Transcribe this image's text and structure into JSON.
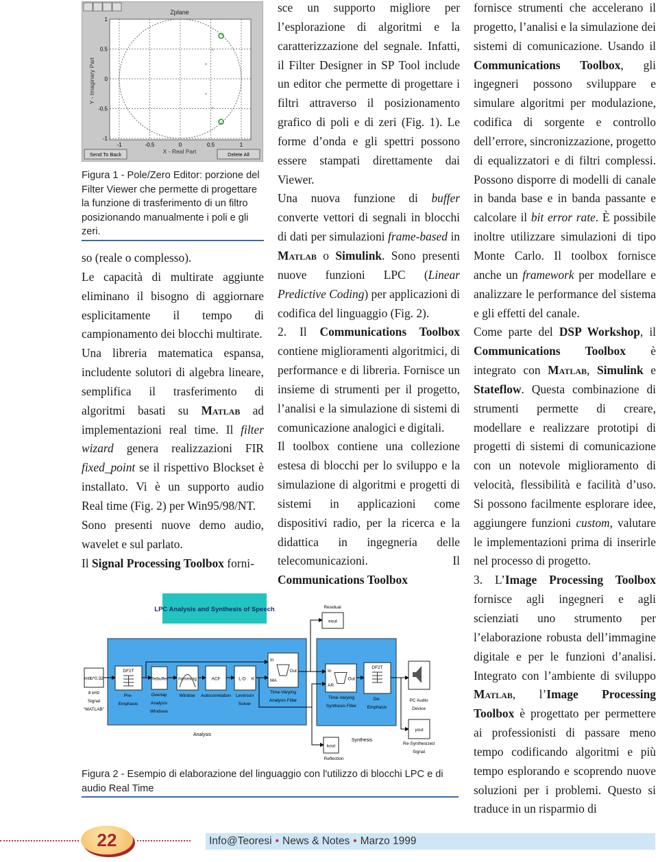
{
  "figure1": {
    "title": "Zplane",
    "toolbar_icons": [
      "pointer-icon",
      "add-pole-icon",
      "add-zero-icon",
      "erase-icon"
    ],
    "ylabel": "Y - Imaginary Part",
    "xlabel": "X - Real Part",
    "xticks": [
      "-1",
      "-0.5",
      "0",
      "0.5",
      "1"
    ],
    "yticks": [
      "1",
      "0.5",
      "0",
      "-0.5",
      "-1"
    ],
    "xlim": [
      -1,
      1
    ],
    "ylim": [
      -1,
      1
    ],
    "zeros": [
      [
        0.67,
        0.72
      ],
      [
        0.67,
        -0.72
      ]
    ],
    "poles": [
      [
        0.53,
        0.49
      ],
      [
        0.42,
        0.25
      ],
      [
        0.42,
        -0.25
      ],
      [
        0.53,
        -0.49
      ]
    ],
    "zero_color": "#2a9a2a",
    "send_to_back_button": "Send To Back",
    "delete_all_button": "Delete All",
    "caption": "Figura 1 - Pole/Zero Editor: porzione del Filter Viewer che permette di progettare la funzione di trasferimento di un filtro posizionando manualmente i poli e gli zeri."
  },
  "figure2": {
    "title": "LPC Analysis and Synthesis of Speech",
    "title_color": "#22c4c0",
    "panel_color": "#4aa8ea",
    "analysis_label": "Analysis",
    "synthesis_label": "Synthesis",
    "blocks": {
      "source": {
        "text": "mtlb*0.32",
        "label": [
          "8 kHz",
          "Signal",
          "\"MATLAB\""
        ]
      },
      "preemphasis": {
        "text": "DF2T",
        "label": [
          "Pre-",
          "Emphasis"
        ]
      },
      "rebuffer": {
        "text": "Rebuffer",
        "label": [
          "Overlap",
          "Analysis",
          "Windows"
        ]
      },
      "window": {
        "text": "hamming",
        "label": [
          "Window"
        ]
      },
      "acf": {
        "text": "ACF",
        "label": [
          "Autocorrelation"
        ]
      },
      "levinson": {
        "text": "L-D",
        "port": "K",
        "label": [
          "Levinson",
          "Solver"
        ]
      },
      "analysis_filter": {
        "ports": [
          "In",
          "MA",
          "Out"
        ],
        "label": [
          "Time-Varying",
          "Analysis Filter"
        ]
      },
      "synthesis_filter": {
        "ports": [
          "In",
          "AR",
          "Out"
        ],
        "label": [
          "Time-Varying",
          "Synthesis Filter"
        ]
      },
      "deemphasis": {
        "text": "DF2T",
        "label": [
          "De-",
          "Emphasis"
        ]
      },
      "audio_device": {
        "label": [
          "PC Audio",
          "Device"
        ]
      },
      "yout": {
        "text": "yout",
        "label": [
          "Re-Synthesized",
          "Signal"
        ]
      },
      "eout": {
        "text": "eout",
        "label": [
          "Residual"
        ]
      },
      "kout": {
        "text": "kout",
        "label": [
          "Reflection"
        ]
      }
    },
    "caption": "Figura 2 - Esempio di elaborazione del linguaggio con l'utilizzo di blocchi LPC e di audio Real Time"
  },
  "columns": [
    [
      [
        {
          "t": "so (reale o complesso)."
        }
      ],
      [
        {
          "t": "Le capacità di multirate aggiunte eliminano il bisogno di aggiornare esplicitamente il tempo di campionamento dei blocchi multirate."
        }
      ],
      [
        {
          "t": "Una libreria matematica espansa, includente solutori di algebra lineare, semplifica il trasferimento di algoritmi basati su "
        },
        {
          "t": "Matlab",
          "s": "sc"
        },
        {
          "t": " ad implementazioni real time. Il "
        },
        {
          "t": "filter wizard",
          "s": "i"
        },
        {
          "t": " genera realizzazioni FIR "
        },
        {
          "t": "fixed_point",
          "s": "i"
        },
        {
          "t": " se il rispettivo Blockset è installato. Vi è un supporto audio Real time (Fig. 2) per Win95/98/NT."
        }
      ],
      [
        {
          "t": "Sono presenti nuove demo audio, wavelet e sul parlato."
        }
      ],
      [
        {
          "t": "Il "
        },
        {
          "t": "Signal Processing Toolbox",
          "s": "b"
        },
        {
          "t": " forni-"
        }
      ]
    ],
    [
      [
        {
          "t": "sce un supporto migliore per l’esplorazione di algoritmi e la caratterizzazione del segnale. Infatti, il Filter Designer in SP Tool include un editor che permette di progettare i filtri attraverso il posizionamento grafico di poli e di zeri (Fig. 1). Le forme d’onda e gli spettri possono essere stampati direttamente dai Viewer."
        }
      ],
      [
        {
          "t": "Una nuova funzione di "
        },
        {
          "t": "buffer",
          "s": "i"
        },
        {
          "t": " converte vettori di segnali in blocchi di dati per simulazioni "
        },
        {
          "t": "frame-based",
          "s": "i"
        },
        {
          "t": " in "
        },
        {
          "t": "Matlab",
          "s": "sc"
        },
        {
          "t": " o "
        },
        {
          "t": "Simulink",
          "s": "b"
        },
        {
          "t": ". Sono presenti nuove funzioni LPC ("
        },
        {
          "t": "Linear Predictive Coding",
          "s": "i"
        },
        {
          "t": ") per applicazioni di codifica del linguaggio (Fig. 2)."
        }
      ],
      [
        {
          "t": "2. Il "
        },
        {
          "t": "Communications Toolbox",
          "s": "b"
        },
        {
          "t": " contiene miglioramenti algoritmici, di performance e di libreria. Fornisce un insieme di strumenti per il progetto, l’analisi e la simulazione di sistemi di comunicazione analogici e digitali."
        }
      ],
      [
        {
          "t": "Il toolbox contiene una collezione estesa di blocchi per lo sviluppo e la simulazione di algoritmi e progetti di sistemi in applicazioni come dispositivi radio, per la ricerca e la didattica in ingegneria delle telecomunicazioni. Il "
        },
        {
          "t": "Communications Toolbox",
          "s": "b"
        }
      ]
    ],
    [
      [
        {
          "t": "fornisce strumenti che accelerano il progetto, l’analisi e la simulazione dei sistemi di comunicazione. Usando il "
        },
        {
          "t": "Communications Toolbox",
          "s": "b"
        },
        {
          "t": ", gli ingegneri possono sviluppare e simulare algoritmi per modulazione, codifica di sorgente e controllo dell’errore, sincronizzazione, progetto di equalizzatori e di filtri complessi. Possono disporre di modelli di canale in banda base e in banda passante e calcolare il "
        },
        {
          "t": "bit error rate",
          "s": "i"
        },
        {
          "t": ". È possibile inoltre utilizzare simulazioni di tipo Monte Carlo. Il toolbox fornisce anche un "
        },
        {
          "t": "framework",
          "s": "i"
        },
        {
          "t": " per modellare e analizzare le performance del sistema e gli effetti del canale."
        }
      ],
      [
        {
          "t": "Come parte del "
        },
        {
          "t": "DSP Workshop",
          "s": "b"
        },
        {
          "t": ", il "
        },
        {
          "t": "Communications Toolbox",
          "s": "b"
        },
        {
          "t": " è integrato con "
        },
        {
          "t": "Matlab",
          "s": "sc"
        },
        {
          "t": ", "
        },
        {
          "t": "Simulink",
          "s": "b"
        },
        {
          "t": " e "
        },
        {
          "t": "Stateflow",
          "s": "b"
        },
        {
          "t": ". Questa combinazione di strumenti permette di creare, modellare e realizzare prototipi di progetti di sistemi di comunicazione con un notevole miglioramento di velocità, flessibilità e facilità d’uso. Si possono facilmente esplorare idee, aggiungere funzioni "
        },
        {
          "t": "custom",
          "s": "i"
        },
        {
          "t": ", valutare le implementazioni prima di inserirle nel processo di progetto."
        }
      ],
      [
        {
          "t": "3. L’"
        },
        {
          "t": "Image Processing Toolbox",
          "s": "b"
        },
        {
          "t": " fornisce agli ingegneri e agli scienziati uno strumento per l’elaborazione robusta dell’immagine digitale e per le funzioni d’analisi. Integrato con l’ambiente di sviluppo "
        },
        {
          "t": "Matlab",
          "s": "sc"
        },
        {
          "t": ", l’"
        },
        {
          "t": "Image Processing Toolbox",
          "s": "b"
        },
        {
          "t": " è progettato per permettere ai professionisti di passare meno tempo codificando algoritmi e più tempo esplorando e scoprendo nuove soluzioni per i problemi. Questo si traduce in un risparmio di"
        }
      ]
    ]
  ],
  "footer": {
    "page_number": "22",
    "publication": "Info@Teoresi",
    "section": "News & Notes",
    "date": "Marzo 1999",
    "accent": "#a82828",
    "bar_color": "#cfe6f7"
  }
}
